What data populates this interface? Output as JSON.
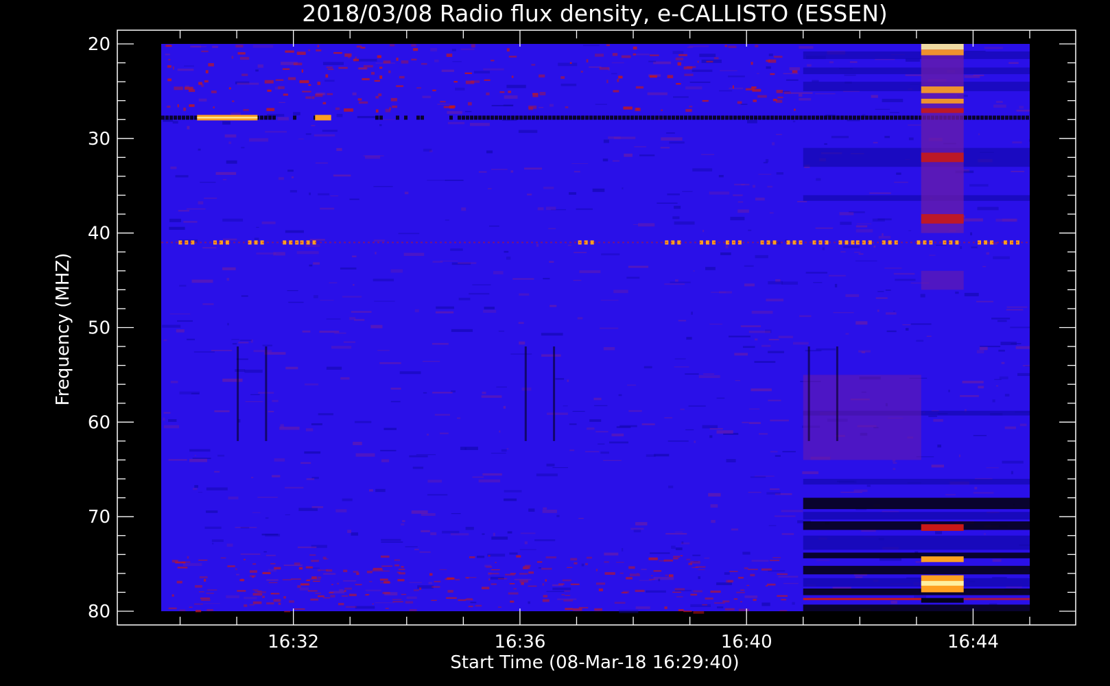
{
  "chart_data": {
    "type": "heatmap",
    "title": "2018/03/08  Radio flux density, e-CALLISTO (ESSEN)",
    "xlabel": "Start Time (08-Mar-18 16:29:40)",
    "ylabel": "Frequency (MHZ)",
    "x_range": [
      "16:29:40",
      "16:45:00"
    ],
    "y_range": [
      20,
      80
    ],
    "y_inverted": true,
    "y_ticks": [
      20,
      30,
      40,
      50,
      60,
      70,
      80
    ],
    "x_ticks": [
      "16:32",
      "16:36",
      "16:40",
      "16:44"
    ],
    "colors": {
      "background": "#000000",
      "axes": "#ffffff",
      "base": "#2a10e8",
      "low": "#1408b0",
      "mid": "#6a1ca8",
      "high": "#c81818",
      "peak": "#ffa020",
      "max": "#fff0a0"
    },
    "features": [
      {
        "name": "interference line",
        "freq": 27.8,
        "start": "16:29:40",
        "end": "16:45:00",
        "level": "low"
      },
      {
        "name": "interference line",
        "freq": 41.0,
        "start": "16:29:40",
        "end": "16:45:00",
        "level": "peak-dashed"
      },
      {
        "name": "burst",
        "freq": [
          20,
          40
        ],
        "start": "16:43:05",
        "end": "16:43:50",
        "level": "high"
      },
      {
        "name": "burst",
        "freq": [
          74,
          79
        ],
        "start": "16:43:05",
        "end": "16:43:50",
        "level": "peak"
      },
      {
        "name": "enhanced band",
        "freq": [
          55,
          64
        ],
        "start": "16:41:00",
        "end": "16:43:05",
        "level": "mid"
      },
      {
        "name": "dark bands",
        "freq": [
          68,
          80
        ],
        "start": "16:41:00",
        "end": "16:45:00",
        "level": "low"
      }
    ]
  }
}
